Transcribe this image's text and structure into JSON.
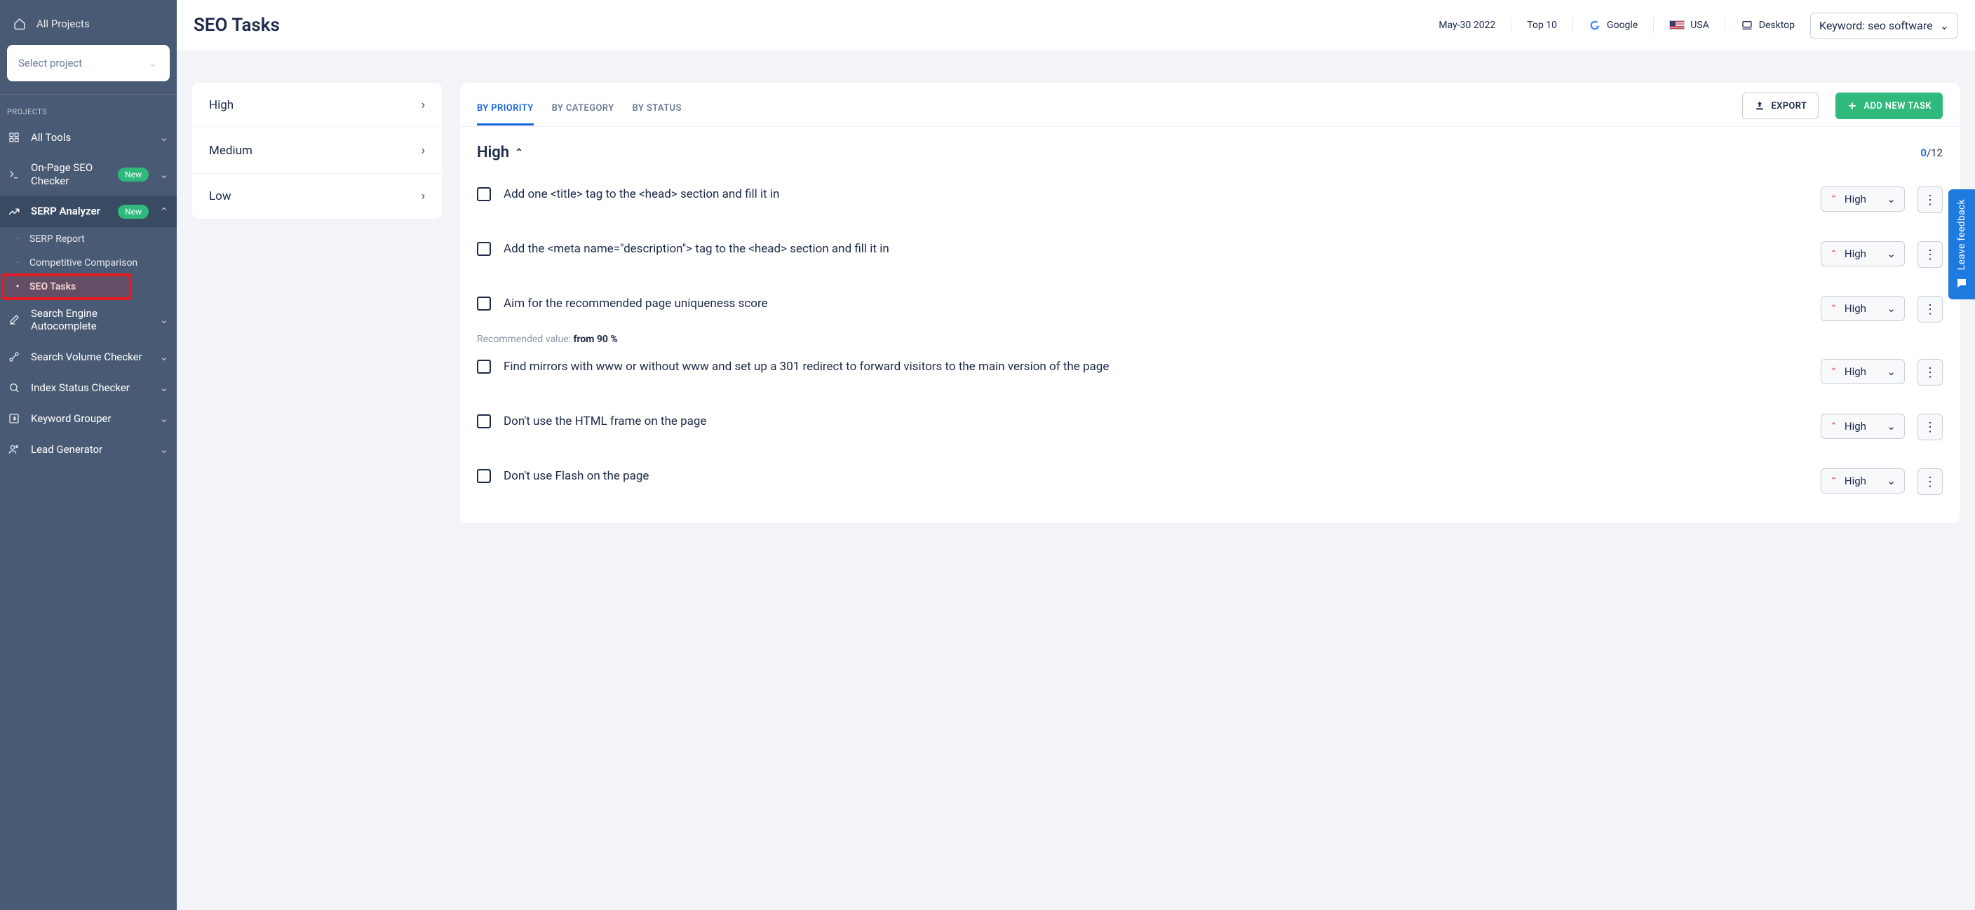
{
  "sidebar": {
    "all_projects": "All Projects",
    "select_placeholder": "Select project",
    "section_label": "PROJECTS",
    "items": [
      {
        "label": "All Tools"
      },
      {
        "label": "On-Page SEO Checker",
        "badge": "New"
      },
      {
        "label": "SERP Analyzer",
        "badge": "New"
      },
      {
        "label": "Search Engine Autocomplete"
      },
      {
        "label": "Search Volume Checker"
      },
      {
        "label": "Index Status Checker"
      },
      {
        "label": "Keyword Grouper"
      },
      {
        "label": "Lead Generator"
      }
    ],
    "serp_sub": [
      {
        "label": "SERP Report"
      },
      {
        "label": "Competitive Comparison"
      },
      {
        "label": "SEO Tasks"
      }
    ]
  },
  "header": {
    "title": "SEO Tasks",
    "date": "May-30 2022",
    "rank": "Top 10",
    "engine": "Google",
    "country": "USA",
    "device": "Desktop",
    "keyword": "Keyword: seo software"
  },
  "priority_col": {
    "items": [
      "High",
      "Medium",
      "Low"
    ]
  },
  "panel": {
    "tabs": [
      "BY PRIORITY",
      "BY CATEGORY",
      "BY STATUS"
    ],
    "export": "EXPORT",
    "add_task": "ADD NEW TASK",
    "group_title": "High",
    "count_done": "0",
    "count_total": "/12",
    "recommended_label": "Recommended value: ",
    "recommended_value": "from 90 %",
    "priority_label": "High",
    "tasks": [
      "Add one <title> tag to the <head> section and fill it in",
      "Add the <meta name=\"description\"> tag to the <head> section and fill it in",
      "Aim for the recommended page uniqueness score",
      "Find mirrors with www or without www and set up a 301 redirect to forward visitors to the main version of the page",
      "Don't use the HTML frame on the page",
      "Don't use Flash on the page"
    ]
  },
  "feedback": "Leave feedback"
}
